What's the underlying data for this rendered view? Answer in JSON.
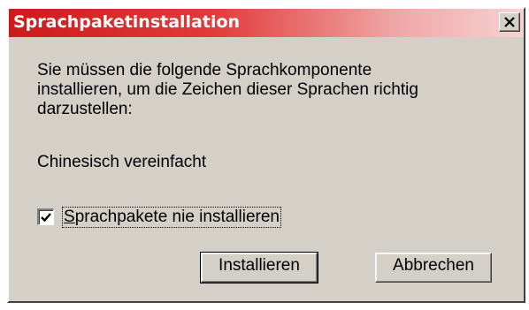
{
  "window": {
    "title": "Sprachpaketinstallation",
    "close_label": "×"
  },
  "message": {
    "lines": [
      "Sie müssen die folgende Sprachkomponente",
      "installieren, um die Zeichen dieser Sprachen richtig",
      "darzustellen:"
    ]
  },
  "language": "Chinesisch vereinfacht",
  "checkbox": {
    "mnemonic": "S",
    "label_rest": "prachpakete nie installieren",
    "checked": true
  },
  "buttons": {
    "install_label": "Installieren",
    "cancel_label": "Abbrechen"
  },
  "colors": {
    "title_gradient_start": "#ce1a1c",
    "title_gradient_end": "#f7d2d2",
    "face": "#d4d0c8"
  }
}
